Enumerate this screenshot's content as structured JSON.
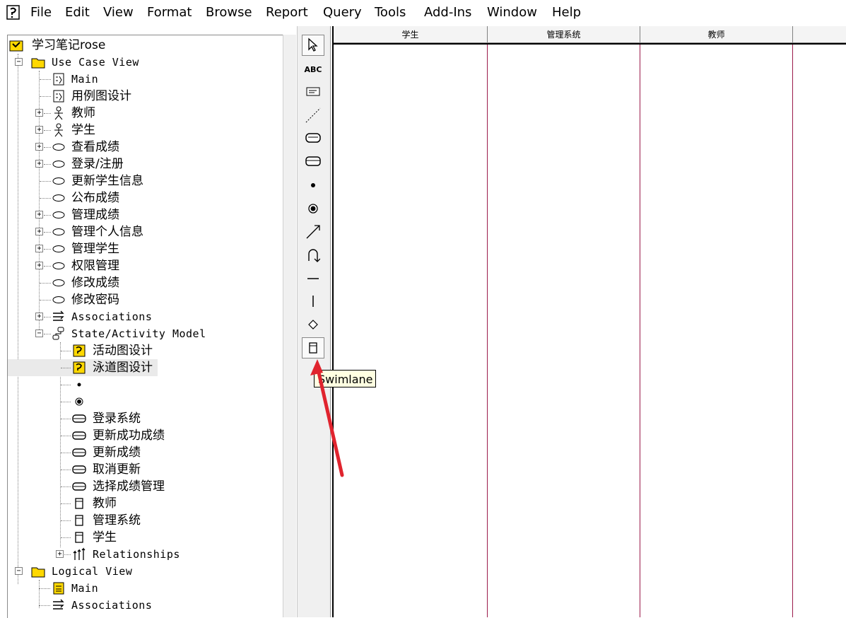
{
  "menu": [
    "File",
    "Edit",
    "View",
    "Format",
    "Browse",
    "Report",
    "Query",
    "Tools",
    "Add-Ins",
    "Window",
    "Help"
  ],
  "tree": {
    "root": "学习笔记rose",
    "use_case_view": "Use Case View",
    "uc_items": [
      "Main",
      "用例图设计",
      "教师",
      "学生",
      "查看成绩",
      "登录/注册",
      "更新学生信息",
      "公布成绩",
      "管理成绩",
      "管理个人信息",
      "管理学生",
      "权限管理",
      "修改成绩",
      "修改密码",
      "Associations",
      "State/Activity Model"
    ],
    "sa_items": [
      "活动图设计",
      "泳道图设计"
    ],
    "activities": [
      "登录系统",
      "更新成功成绩",
      "更新成绩",
      "取消更新",
      "选择成绩管理"
    ],
    "swimlanes": [
      "教师",
      "管理系统",
      "学生"
    ],
    "relationships": "Relationships",
    "logical_view": "Logical View",
    "lv_items": [
      "Main",
      "Associations"
    ]
  },
  "toolbox": {
    "items": [
      "selector-tool",
      "text-tool",
      "note-tool",
      "anchor-note-tool",
      "activity-tool",
      "state-tool",
      "start-state-tool",
      "end-state-tool",
      "transition-tool",
      "self-transition-tool",
      "horizontal-sync-tool",
      "vertical-sync-tool",
      "decision-tool",
      "swimlane-tool"
    ],
    "abc_label": "ABC"
  },
  "diagram": {
    "lanes": [
      "学生",
      "管理系统",
      "教师"
    ]
  },
  "tooltip": "Swimlane",
  "colors": {
    "lane_line": "#9b1b4b",
    "annotation_arrow": "#e0242e",
    "tooltip_bg": "#ffffe1"
  }
}
